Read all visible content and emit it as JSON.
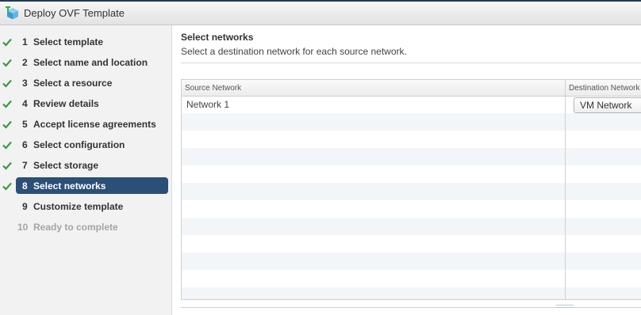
{
  "window": {
    "title": "Deploy OVF Template"
  },
  "steps": [
    {
      "num": "1",
      "label": "Select template",
      "state": "done"
    },
    {
      "num": "2",
      "label": "Select name and location",
      "state": "done"
    },
    {
      "num": "3",
      "label": "Select a resource",
      "state": "done"
    },
    {
      "num": "4",
      "label": "Review details",
      "state": "done"
    },
    {
      "num": "5",
      "label": "Accept license agreements",
      "state": "done"
    },
    {
      "num": "6",
      "label": "Select configuration",
      "state": "done"
    },
    {
      "num": "7",
      "label": "Select storage",
      "state": "done"
    },
    {
      "num": "8",
      "label": "Select networks",
      "state": "active"
    },
    {
      "num": "9",
      "label": "Customize template",
      "state": "pending"
    },
    {
      "num": "10",
      "label": "Ready to complete",
      "state": "disabled"
    }
  ],
  "main": {
    "heading": "Select networks",
    "subtitle": "Select a destination network for each source network."
  },
  "table": {
    "columns": [
      "Source Network",
      "Destination Network"
    ],
    "rows": [
      {
        "source": "Network 1",
        "destination": "VM Network"
      }
    ]
  },
  "colors": {
    "active_step": "#2b4f76",
    "check": "#3c9a3c",
    "disabled_text": "#a4a4a4"
  },
  "icons": {
    "title": "ovf-template-icon",
    "done": "checkmark-icon"
  }
}
